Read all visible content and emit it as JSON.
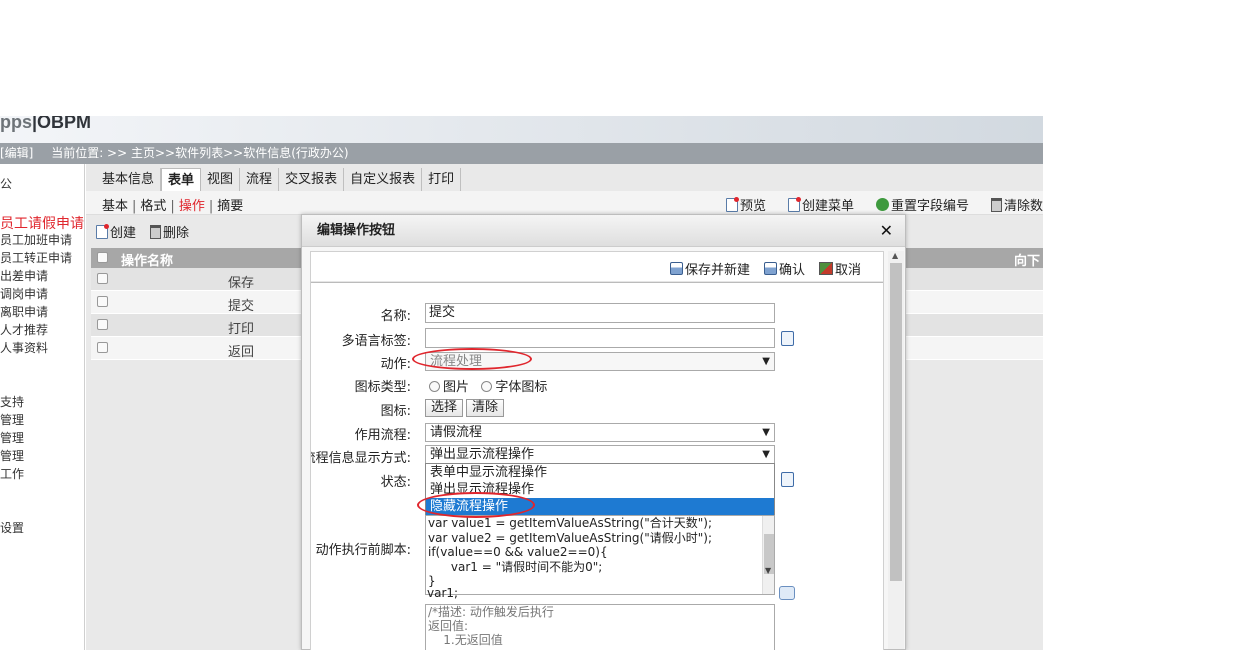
{
  "app": {
    "brand_dim": "pps",
    "brand": "|OBPM"
  },
  "location": {
    "edit": "[编辑]",
    "text": "当前位置: >> 主页>>软件列表>>软件信息(行政办公)"
  },
  "sidebar": {
    "items": [
      {
        "label": "公",
        "top": 0
      },
      {
        "label": "员工请假申请",
        "active": true
      },
      {
        "label": "员工加班申请"
      },
      {
        "label": "员工转正申请"
      },
      {
        "label": "出差申请"
      },
      {
        "label": "调岗申请"
      },
      {
        "label": "离职申请"
      },
      {
        "label": "人才推荐"
      },
      {
        "label": "人事资料"
      },
      {
        "label": "支持"
      },
      {
        "label": "管理"
      },
      {
        "label": "管理"
      },
      {
        "label": "管理"
      },
      {
        "label": "工作"
      },
      {
        "label": "设置"
      }
    ]
  },
  "tabs": [
    "基本信息",
    "表单",
    "视图",
    "流程",
    "交叉报表",
    "自定义报表",
    "打印"
  ],
  "subtabs": [
    "基本",
    "格式",
    "操作",
    "摘要"
  ],
  "tools": {
    "preview": "预览",
    "create_menu": "创建菜单",
    "renumber": "重置字段编号",
    "clear": "清除数据"
  },
  "actions": {
    "create": "创建",
    "delete": "删除"
  },
  "list": {
    "header_name": "操作名称",
    "header_right": "向下移",
    "rows": [
      "保存",
      "提交",
      "打印",
      "返回"
    ]
  },
  "modal": {
    "title": "编辑操作按钮",
    "close": "✕",
    "buttons": {
      "save_new": "保存并新建",
      "confirm": "确认",
      "cancel": "取消"
    },
    "fields": {
      "name_label": "名称:",
      "name_value": "提交",
      "i18n_label": "多语言标签:",
      "action_label": "动作:",
      "action_value": "流程处理",
      "icon_type_label": "图标类型:",
      "icon_type_opt1": "图片",
      "icon_type_opt2": "字体图标",
      "icon_label": "图标:",
      "icon_choose": "选择",
      "icon_clear": "清除",
      "flow_label": "作用流程:",
      "flow_value": "请假流程",
      "display_label": "流程信息显示方式:",
      "display_value": "弹出显示流程操作",
      "status_label": "状态:",
      "before_script_label": "动作执行前脚本:"
    },
    "dropdown_options": [
      "表单中显示流程操作",
      "弹出显示流程操作",
      "隐藏流程操作"
    ],
    "script_lines": [
      "var value1 = getItemValueAsString(\"合计天数\");",
      "var value2 = getItemValueAsString(\"请假小时\");",
      "if(value==0 && value2==0){",
      "      var1 = \"请假时间不能为0\";",
      "}",
      "var1;"
    ],
    "desc_lines": [
      "/*描述: 动作触发后执行",
      "返回值:",
      "    1.无返回值"
    ]
  },
  "colors": {
    "accent_red": "#e0262d",
    "highlight_blue": "#1e7ad2",
    "location_bar": "#9aa0a6"
  }
}
